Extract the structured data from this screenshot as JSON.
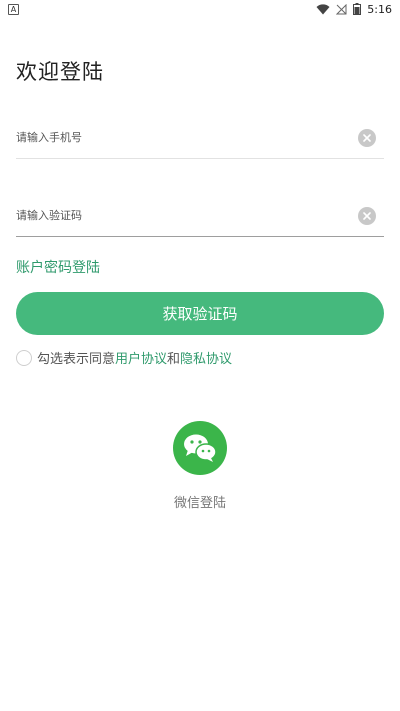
{
  "status_bar": {
    "app_glyph": "A",
    "time": "5:16",
    "icons": [
      "wifi-icon",
      "signal-icon",
      "battery-icon"
    ]
  },
  "page": {
    "title": "欢迎登陆"
  },
  "phone_field": {
    "placeholder": "请输入手机号",
    "value": ""
  },
  "code_field": {
    "placeholder": "请输入验证码",
    "value": ""
  },
  "password_login_link": "账户密码登陆",
  "get_code_button": "获取验证码",
  "agreement": {
    "prefix": "勾选表示同意",
    "user_agreement": "用户协议",
    "conjunction": "和",
    "privacy_agreement": "隐私协议",
    "checked": false
  },
  "wechat_login": {
    "label": "微信登陆"
  },
  "colors": {
    "accent": "#45b97d",
    "link": "#2f9a6c",
    "wechat": "#3bb54a"
  }
}
